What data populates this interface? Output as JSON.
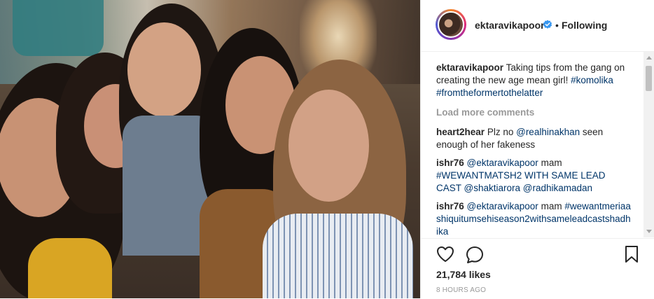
{
  "post": {
    "username": "ektaravikapoor",
    "follow_separator": "•",
    "follow_status": "Following",
    "caption": {
      "username": "ektaravikapoor",
      "text": "Taking tips from the gang on creating the new age mean girl!",
      "hashtag1": "#komolika",
      "hashtag2": "#fromtheformertothelatter"
    },
    "load_more": "Load more comments",
    "comments": [
      {
        "username": "heart2hear",
        "text_before": "Plz no",
        "mention": "@realhinakhan",
        "text_after": "seen enough of her fakeness"
      },
      {
        "username": "ishr76",
        "mention1": "@ektaravikapoor",
        "text1": "mam",
        "text2": "#WEWANTMATSH2 WITH SAME LEAD CAST",
        "mention2": "@shaktiarora",
        "mention3": "@radhikamadan"
      },
      {
        "username": "ishr76",
        "mention1": "@ektaravikapoor",
        "text1": "mam",
        "hashtag": "#wewantmeriaashiquitumsehiseason2withsameleadcastshadhika"
      }
    ],
    "likes": "21,784 likes",
    "time": "8 HOURS AGO"
  },
  "icons": {
    "verified": "verified-badge-icon",
    "like": "heart-icon",
    "comment": "comment-bubble-icon",
    "save": "bookmark-icon"
  },
  "colors": {
    "link": "#003569",
    "verified": "#3897f0",
    "muted": "#999999"
  }
}
